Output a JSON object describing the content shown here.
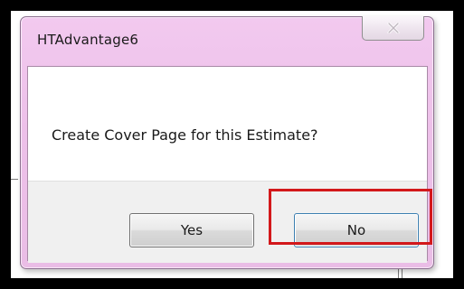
{
  "window": {
    "title": "HTAdvantage6",
    "close_icon": "close-x-icon"
  },
  "dialog": {
    "message": "Create Cover Page for this Estimate?",
    "yes_label": "Yes",
    "no_label": "No"
  },
  "colors": {
    "frame": "#f0c6ec",
    "highlight": "#d3181b",
    "backdrop": "#000000"
  }
}
